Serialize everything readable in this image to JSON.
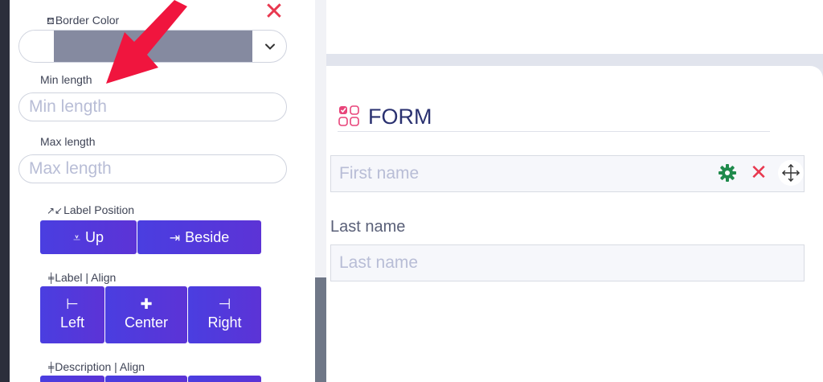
{
  "panel": {
    "border_color": {
      "icon": "paint-bucket-icon",
      "label": "Border Color",
      "swatch_color": "#858aa0"
    },
    "close_glyph": "✕",
    "min_length": {
      "label": "Min length",
      "placeholder": "Min length"
    },
    "max_length": {
      "label": "Max length",
      "placeholder": "Max length"
    },
    "label_position": {
      "icon": "collapse-arrows-icon",
      "label": "Label Position",
      "buttons": [
        {
          "icon": "align-down-icon",
          "label": "Up"
        },
        {
          "icon": "align-right-bar-icon",
          "label": "Beside"
        }
      ]
    },
    "label_align": {
      "icon": "align-line-icon",
      "label": "Label | Align",
      "buttons": [
        {
          "icon": "align-left-icon",
          "label": "Left"
        },
        {
          "icon": "align-center-icon",
          "label": "Center"
        },
        {
          "icon": "align-right-icon",
          "label": "Right"
        }
      ]
    },
    "description_align": {
      "icon": "align-line-icon",
      "label": "Description | Align"
    }
  },
  "form": {
    "icon": "form-grid-icon",
    "title": "FORM",
    "fields": [
      {
        "label": "",
        "placeholder": "First name"
      },
      {
        "label": "Last name",
        "placeholder": "Last name"
      }
    ],
    "tools": {
      "settings": "gear-icon",
      "remove": "✕",
      "move": "move-icon"
    }
  },
  "colors": {
    "accent": "#4a3ee0",
    "delete_red": "#e8384f",
    "title_navy": "#2a3170",
    "gear_green": "#1f8a4c",
    "annotation_arrow": "#f0153e"
  }
}
